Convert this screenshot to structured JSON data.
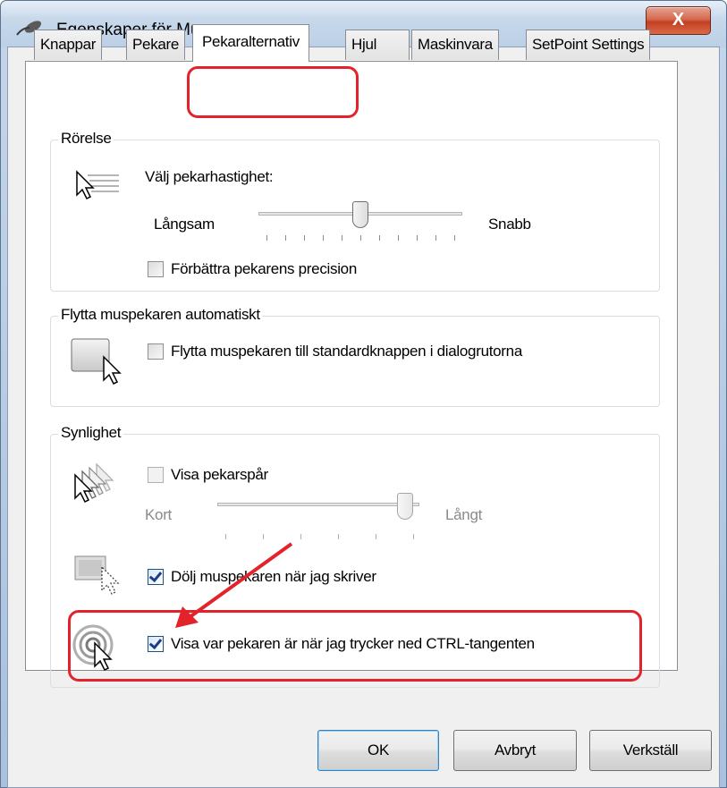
{
  "window": {
    "title": "Egenskaper för Mus",
    "close_glyph": "X",
    "icon": "mouse-pointer-icon"
  },
  "tabs": [
    {
      "label": "Knappar",
      "active": false
    },
    {
      "label": "Pekare",
      "active": false
    },
    {
      "label": "Pekaralternativ",
      "active": true
    },
    {
      "label": "Hjul",
      "active": false
    },
    {
      "label": "Maskinvara",
      "active": false
    },
    {
      "label": "SetPoint Settings",
      "active": false
    }
  ],
  "motion": {
    "legend": "Rörelse",
    "speed_label": "Välj pekarhastighet:",
    "slow_label": "Långsam",
    "fast_label": "Snabb",
    "speed_level": 0.5,
    "precision_label": "Förbättra pekarens precision",
    "precision_checked": false
  },
  "snap": {
    "legend": "Flytta muspekaren automatiskt",
    "snap_label": "Flytta muspekaren till standardknappen i dialogrutorna",
    "snap_checked": false
  },
  "visibility": {
    "legend": "Synlighet",
    "trails_label": "Visa pekarspår",
    "trails_checked": false,
    "short_label": "Kort",
    "long_label": "Långt",
    "trail_level": 1.0,
    "hide_label": "Dölj muspekaren när jag skriver",
    "hide_checked": true,
    "ctrl_label": "Visa var pekaren är när jag trycker ned CTRL-tangenten",
    "ctrl_checked": true
  },
  "buttons": {
    "ok": "OK",
    "cancel": "Avbryt",
    "apply": "Verkställ"
  },
  "annotation_color": "#e3232c"
}
